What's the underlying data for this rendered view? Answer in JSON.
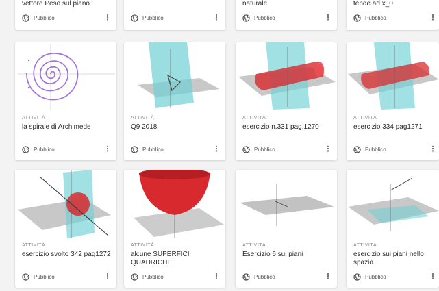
{
  "top_row": [
    {
      "title": "vettore Peso sul piano",
      "visibility": "Pubblico"
    },
    {
      "title": "",
      "visibility": "Pubblico"
    },
    {
      "title": "naturale",
      "visibility": "Pubblico"
    },
    {
      "title": "tende ad x_0",
      "visibility": "Pubblico"
    }
  ],
  "middle_row": [
    {
      "kind": "ATTIVITÀ",
      "title": "la spirale di Archimede",
      "visibility": "Pubblico"
    },
    {
      "kind": "ATTIVITÀ",
      "title": "Q9 2018",
      "visibility": "Pubblico"
    },
    {
      "kind": "ATTIVITÀ",
      "title": "esercizio n.331 pag.1270",
      "visibility": "Pubblico"
    },
    {
      "kind": "ATTIVITÀ",
      "title": "esercizio 334 pag1271",
      "visibility": "Pubblico"
    }
  ],
  "bottom_row": [
    {
      "kind": "ATTIVITÀ",
      "title": "esercizio svolto 342 pag1272",
      "visibility": "Pubblico"
    },
    {
      "kind": "ATTIVITÀ",
      "title": "alcune SUPERFICI QUADRICHE",
      "visibility": "Pubblico"
    },
    {
      "kind": "ATTIVITÀ",
      "title": "Esercizio 6 sui piani",
      "visibility": "Pubblico"
    },
    {
      "kind": "ATTIVITÀ",
      "title": "esercizio sui piani nello spazio",
      "visibility": "Pubblico"
    }
  ],
  "menu_icon": "more-vertical-icon",
  "visibility_icon": "globe-icon",
  "colors": {
    "plane_cyan": "#6fd0d4",
    "plane_gray": "#9a9a9a",
    "surface_red": "#d8292e",
    "spiral_purple": "#a070e0"
  }
}
